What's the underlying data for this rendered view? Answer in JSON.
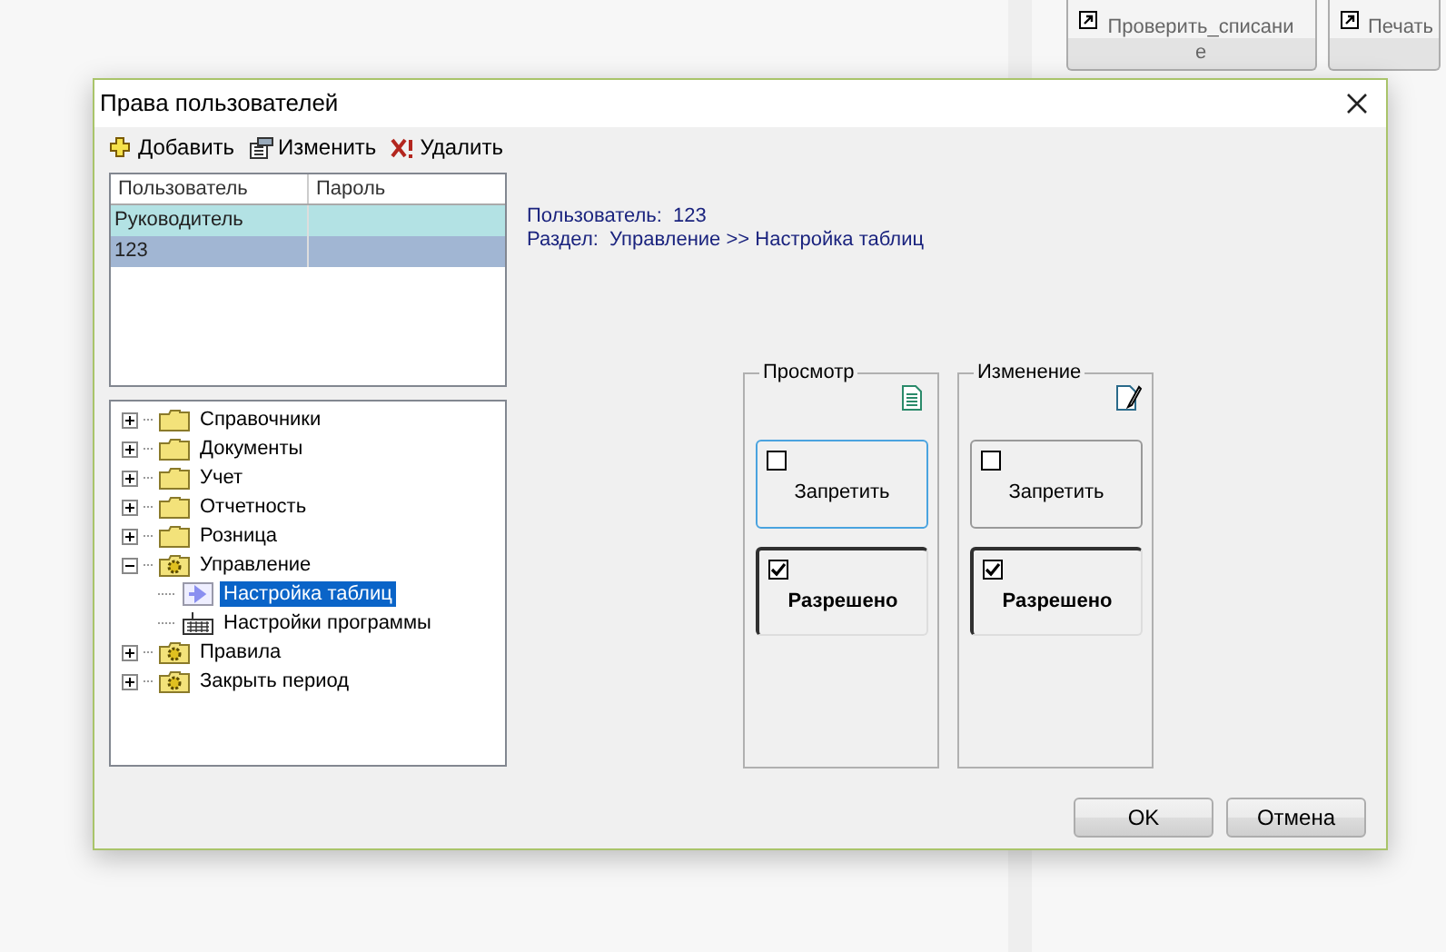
{
  "background_buttons": [
    {
      "label": "Проверить_списание"
    },
    {
      "label": "Печать"
    }
  ],
  "window": {
    "title": "Права пользователей"
  },
  "toolbar": [
    {
      "kind": "add",
      "label": "Добавить"
    },
    {
      "kind": "edit",
      "label": "Изменить"
    },
    {
      "kind": "delete",
      "label": "Удалить"
    }
  ],
  "users_table": {
    "columns": [
      "Пользователь",
      "Пароль"
    ],
    "rows": [
      {
        "cells": [
          "Руководитель",
          ""
        ],
        "selected": false
      },
      {
        "cells": [
          "123",
          ""
        ],
        "selected": true
      }
    ]
  },
  "tree": [
    {
      "label": "Справочники",
      "kind": "folder",
      "expanded": false,
      "selected": false
    },
    {
      "label": "Документы",
      "kind": "folder",
      "expanded": false,
      "selected": false
    },
    {
      "label": "Учет",
      "kind": "folder",
      "expanded": false,
      "selected": false
    },
    {
      "label": "Отчетность",
      "kind": "folder",
      "expanded": false,
      "selected": false
    },
    {
      "label": "Розница",
      "kind": "folder",
      "expanded": false,
      "selected": false
    },
    {
      "label": "Управление",
      "kind": "module",
      "expanded": true,
      "selected": false,
      "children": [
        {
          "label": "Настройка таблиц",
          "kind": "form",
          "selected": true
        },
        {
          "label": "Настройки программы",
          "kind": "settings",
          "selected": false
        }
      ]
    },
    {
      "label": "Правила",
      "kind": "module",
      "expanded": false,
      "selected": false
    },
    {
      "label": "Закрыть период",
      "kind": "module",
      "expanded": false,
      "selected": false
    }
  ],
  "info": [
    "Пользователь:  123",
    "Раздел:  Управление >> Настройка таблиц"
  ],
  "permissions": [
    {
      "title": "Просмотр",
      "kind": "view",
      "options": [
        {
          "label": "Запретить",
          "checked": false,
          "focused": true
        },
        {
          "label": "Разрешено",
          "checked": true,
          "focused": false
        }
      ]
    },
    {
      "title": "Изменение",
      "kind": "edit",
      "options": [
        {
          "label": "Запретить",
          "checked": false,
          "focused": false
        },
        {
          "label": "Разрешено",
          "checked": true,
          "focused": false
        }
      ]
    }
  ],
  "buttons": [
    "OK",
    "Отмена"
  ]
}
